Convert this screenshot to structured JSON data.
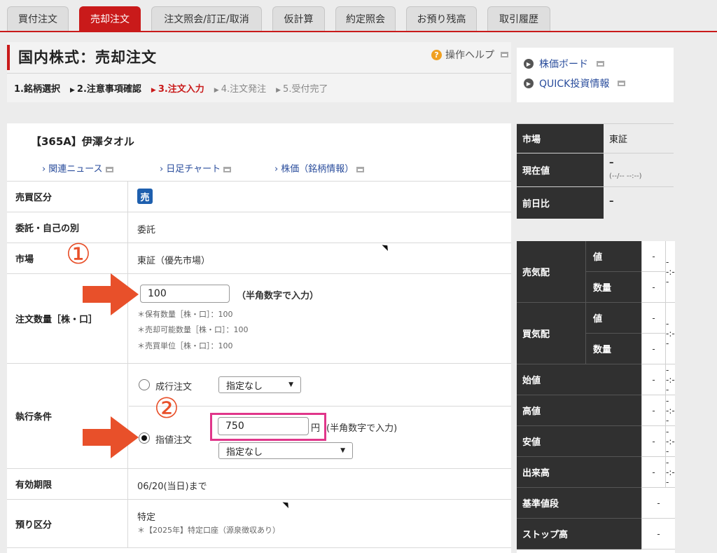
{
  "tabs": [
    {
      "label": "買付注文"
    },
    {
      "label": "売却注文"
    },
    {
      "label": "注文照会/訂正/取消"
    },
    {
      "label": "仮計算"
    },
    {
      "label": "約定照会"
    },
    {
      "label": "お預り残高"
    },
    {
      "label": "取引履歴"
    }
  ],
  "header": {
    "title": "国内株式：売却注文",
    "help": "操作ヘルプ",
    "steps": [
      "1.銘柄選択",
      "2.注意事項確認",
      "3.注文入力",
      "4.注文発注",
      "5.受付完了"
    ]
  },
  "side_links": [
    "株価ボード",
    "QUICK投資情報"
  ],
  "stock": {
    "name": "【365A】伊澤タオル",
    "links": [
      "関連ニュース",
      "日足チャート",
      "株価（銘柄情報）"
    ]
  },
  "form": {
    "trade_type": {
      "label": "売買区分",
      "badge": "売"
    },
    "account_type": {
      "label": "委託・自己の別",
      "value": "委託"
    },
    "market": {
      "label": "市場",
      "value": "東証（優先市場）"
    },
    "quantity": {
      "label": "注文数量［株・口］",
      "value": "100",
      "hint": "（半角数字で入力）",
      "notes": [
        "＊保有数量［株・口］：100",
        "＊売却可能数量［株・口］：100",
        "＊売買単位［株・口］：100"
      ]
    },
    "execution": {
      "label": "執行条件",
      "market_order": {
        "label": "成行注文",
        "select": "指定なし",
        "checked": false
      },
      "limit_order": {
        "label": "指値注文",
        "price": "750",
        "unit": "円",
        "hint": "(半角数字で入力)",
        "select": "指定なし",
        "checked": true
      }
    },
    "expiry": {
      "label": "有効期限",
      "value": "06/20(当日)まで"
    },
    "custody": {
      "label": "預り区分",
      "value": "特定",
      "note": "＊【2025年】特定口座（源泉徴収あり）"
    }
  },
  "annotations": {
    "one": "①",
    "two": "②"
  },
  "info": [
    {
      "label": "市場",
      "value": "東証",
      "sub": ""
    },
    {
      "label": "現在値",
      "value": "–",
      "sub": "(--/-- --:--)"
    },
    {
      "label": "前日比",
      "value": "–",
      "sub": ""
    }
  ],
  "board": {
    "sell": {
      "label": "売気配",
      "rows": [
        {
          "sub": "値",
          "val": "-"
        },
        {
          "sub": "数量",
          "val": "-"
        }
      ],
      "time": "--:--"
    },
    "buy": {
      "label": "買気配",
      "rows": [
        {
          "sub": "値",
          "val": "-"
        },
        {
          "sub": "数量",
          "val": "-"
        }
      ],
      "time": "--:--"
    },
    "rows": [
      {
        "label": "始値",
        "val": "-",
        "time": "--:--"
      },
      {
        "label": "高値",
        "val": "-",
        "time": "--:--"
      },
      {
        "label": "安値",
        "val": "-",
        "time": "--:--"
      },
      {
        "label": "出来高",
        "val": "-",
        "time": "--:--"
      },
      {
        "label": "基準値段",
        "val": "-",
        "time": ""
      },
      {
        "label": "ストップ高",
        "val": "-",
        "time": ""
      }
    ]
  },
  "colors": {
    "accent": "#c91a1a",
    "link": "#2a4d9c",
    "annotation": "#e8502a",
    "highlight": "#e0368a"
  }
}
